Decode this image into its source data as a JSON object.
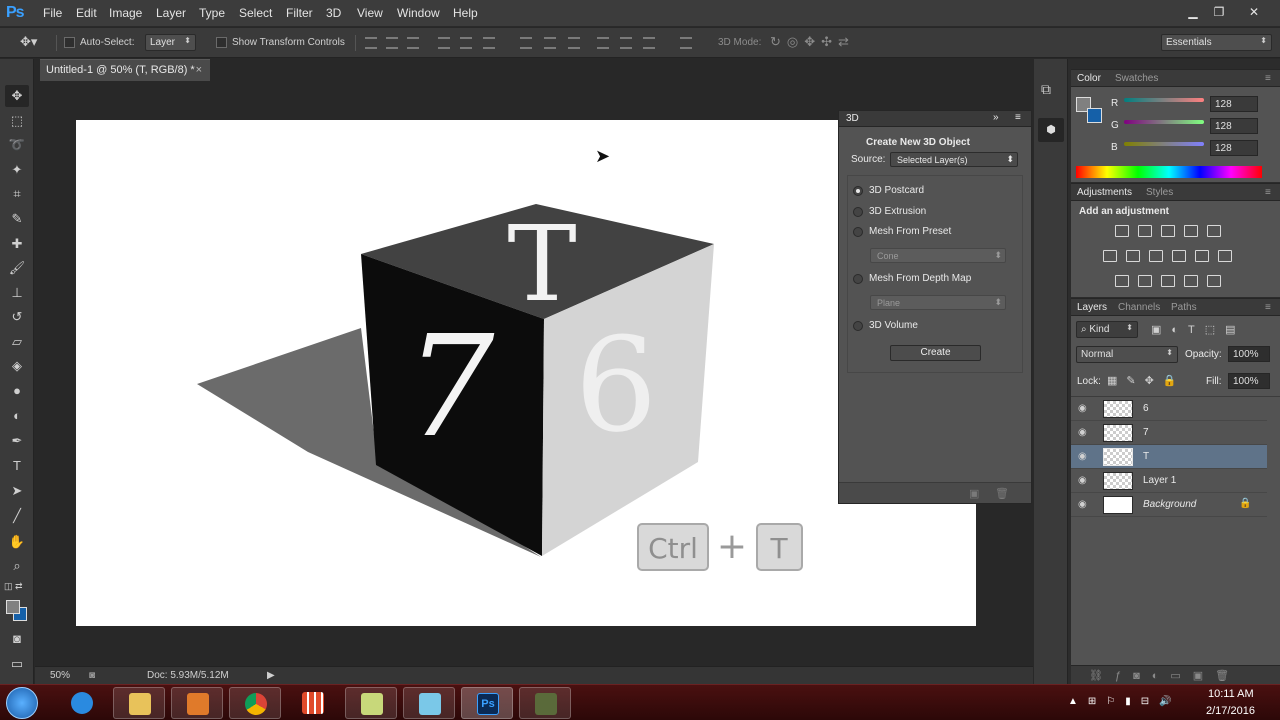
{
  "app": {
    "logo": "Ps"
  },
  "menu": [
    "File",
    "Edit",
    "Image",
    "Layer",
    "Type",
    "Select",
    "Filter",
    "3D",
    "View",
    "Window",
    "Help"
  ],
  "options": {
    "auto_select_label": "Auto-Select:",
    "auto_select_value": "Layer",
    "show_transform_label": "Show Transform Controls",
    "mode_3d_label": "3D Mode:",
    "workspace": "Essentials"
  },
  "document": {
    "tab_title": "Untitled-1 @ 50% (T, RGB/8) *",
    "zoom": "50%",
    "doc_size": "Doc: 5.93M/5.12M"
  },
  "artwork": {
    "top_face": "T",
    "left_face": "7",
    "right_face": "6",
    "key1": "Ctrl",
    "plus": "+",
    "key2": "T"
  },
  "panel_3d": {
    "title": "3D",
    "heading": "Create New 3D Object",
    "source_label": "Source:",
    "source_value": "Selected Layer(s)",
    "options": [
      "3D Postcard",
      "3D Extrusion",
      "Mesh From Preset",
      "Mesh From Depth Map",
      "3D Volume"
    ],
    "preset_value": "Cone",
    "depth_value": "Plane",
    "create_label": "Create"
  },
  "color_panel": {
    "tabs": [
      "Color",
      "Swatches"
    ],
    "channels": [
      {
        "label": "R",
        "value": "128"
      },
      {
        "label": "G",
        "value": "128"
      },
      {
        "label": "B",
        "value": "128"
      }
    ]
  },
  "adjustments_panel": {
    "tabs": [
      "Adjustments",
      "Styles"
    ],
    "heading": "Add an adjustment"
  },
  "layers_panel": {
    "tabs": [
      "Layers",
      "Channels",
      "Paths"
    ],
    "kind": "Kind",
    "blend_mode": "Normal",
    "opacity_label": "Opacity:",
    "opacity_value": "100%",
    "lock_label": "Lock:",
    "fill_label": "Fill:",
    "fill_value": "100%",
    "layers": [
      "6",
      "7",
      "T",
      "Layer 1",
      "Background"
    ]
  },
  "taskbar": {
    "time": "10:11 AM",
    "date": "2/17/2016"
  }
}
